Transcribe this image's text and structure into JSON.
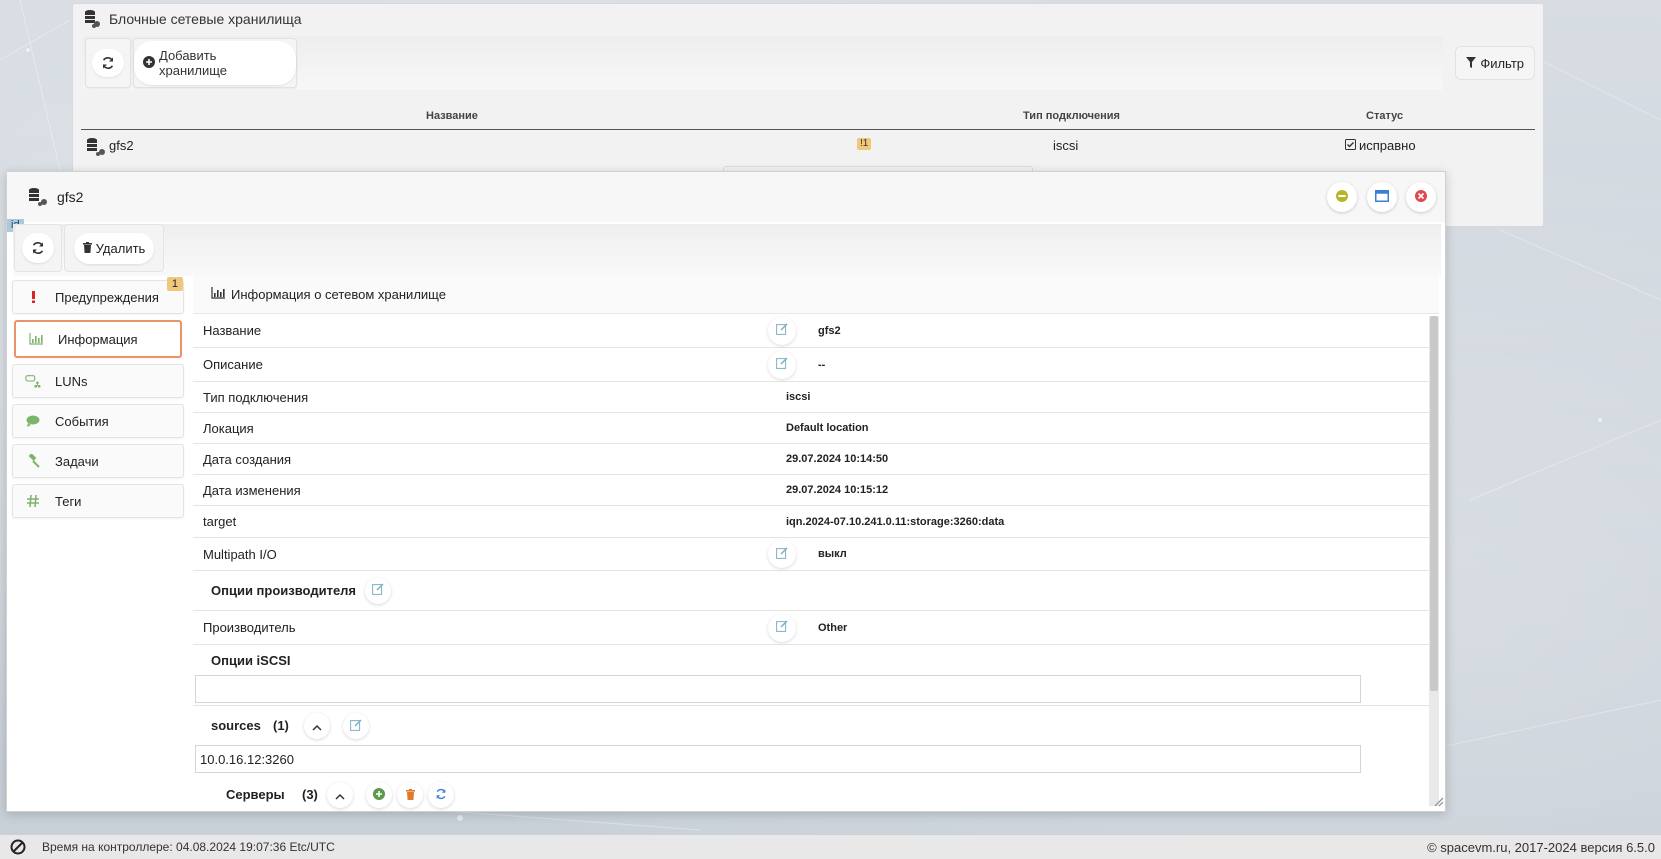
{
  "bg_window": {
    "title": "Блочные сетевые хранилища",
    "add_button": "Добавить хранилище",
    "filter_button": "Фильтр",
    "columns": {
      "name": "Название",
      "conn_type": "Тип подключения",
      "status": "Статус"
    },
    "row": {
      "name": "gfs2",
      "warn_badge": "!1",
      "conn_type": "iscsi",
      "status": "исправно"
    }
  },
  "window": {
    "title": "gfs2",
    "id_tag": "id",
    "delete_button": "Удалить"
  },
  "sidebar": {
    "items": [
      {
        "label": "Предупреждения",
        "badge": "1",
        "icon": "exclamation-icon"
      },
      {
        "label": "Информация",
        "icon": "bar-chart-icon",
        "active": true
      },
      {
        "label": "LUNs",
        "icon": "hdd-network-icon"
      },
      {
        "label": "События",
        "icon": "comment-icon"
      },
      {
        "label": "Задачи",
        "icon": "gavel-icon"
      },
      {
        "label": "Теги",
        "icon": "hashtag-icon"
      }
    ]
  },
  "info": {
    "section_title": "Информация о сетевом хранилище",
    "rows": {
      "name": {
        "label": "Название",
        "value": "gfs2"
      },
      "description": {
        "label": "Описание",
        "value": "--"
      },
      "conn_type": {
        "label": "Тип подключения",
        "value": "iscsi"
      },
      "location": {
        "label": "Локация",
        "value": "Default location"
      },
      "created": {
        "label": "Дата создания",
        "value": "29.07.2024 10:14:50"
      },
      "modified": {
        "label": "Дата изменения",
        "value": "29.07.2024 10:15:12"
      },
      "target": {
        "label": "target",
        "value": "iqn.2024-07.10.241.0.11:storage:3260:data"
      },
      "multipath": {
        "label": "Multipath I/O",
        "value": "выкл"
      }
    },
    "vendor_options": "Опции производителя",
    "vendor": {
      "label": "Производитель",
      "value": "Other"
    },
    "iscsi_options": "Опции iSCSI",
    "sources": {
      "label": "sources",
      "count": "(1)",
      "value": "10.0.16.12:3260"
    },
    "servers": {
      "label": "Серверы",
      "count": "(3)"
    }
  },
  "statusbar": {
    "controller_time": "Время на контроллере: 04.08.2024 19:07:36 Etc/UTC",
    "copyright": "© spacevm.ru, 2017-2024 версия 6.5.0"
  },
  "colors": {
    "accent_orange": "#e8946a",
    "badge_yellow": "#f0c87d",
    "edit_icon": "#7fb0c4",
    "minimize": "#b7b52a",
    "maximize": "#3b7fd6",
    "close": "#e0484e",
    "green_icon": "#7cb46c"
  }
}
